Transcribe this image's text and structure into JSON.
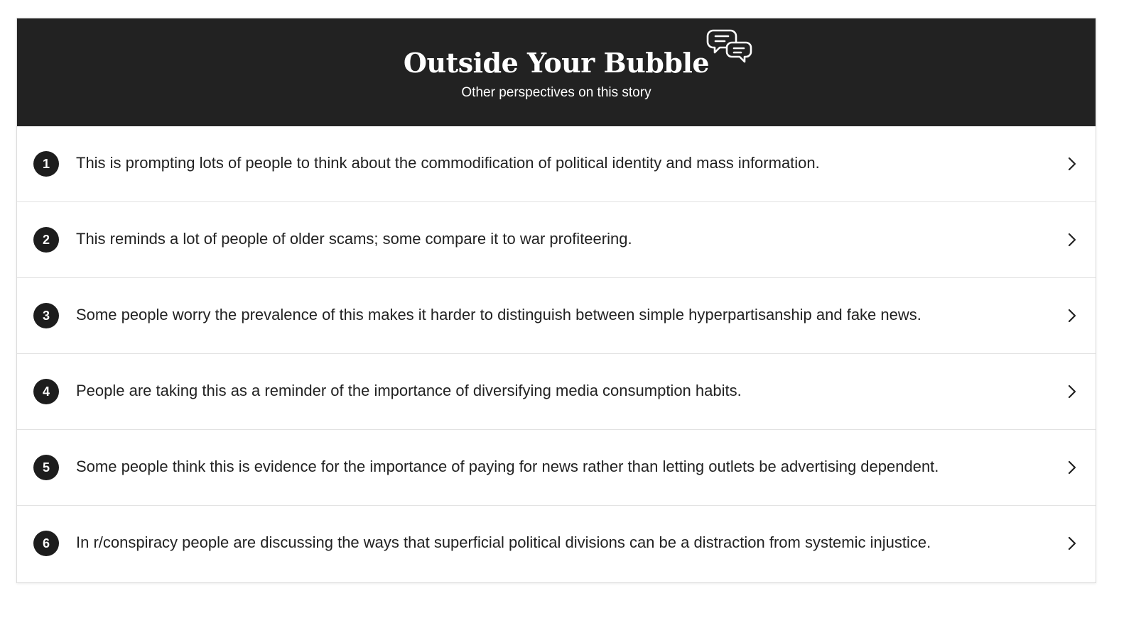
{
  "header": {
    "title": "Outside Your Bubble",
    "subtitle": "Other perspectives on this story",
    "icon": "speech-bubbles-icon"
  },
  "colors": {
    "header_bg": "#222222",
    "badge_bg": "#1d1d1d",
    "text": "#222222",
    "divider": "#e2e2e2"
  },
  "items": [
    {
      "number": "1",
      "text": "This is prompting lots of people to think about the commodification of political identity and mass information.",
      "icon": "chevron-right-icon"
    },
    {
      "number": "2",
      "text": "This reminds a lot of people of older scams; some compare it to war profiteering.",
      "icon": "chevron-right-icon"
    },
    {
      "number": "3",
      "text": "Some people worry the prevalence of this makes it harder to distinguish between simple hyperpartisanship and fake news.",
      "icon": "chevron-right-icon"
    },
    {
      "number": "4",
      "text": "People are taking this as a reminder of the importance of diversifying media consumption habits.",
      "icon": "chevron-right-icon"
    },
    {
      "number": "5",
      "text": "Some people think this is evidence for the importance of paying for news rather than letting outlets be advertising dependent.",
      "icon": "chevron-right-icon"
    },
    {
      "number": "6",
      "text": "In r/conspiracy people are discussing the ways that superficial political divisions can be a distraction from systemic injustice.",
      "icon": "chevron-right-icon"
    }
  ]
}
